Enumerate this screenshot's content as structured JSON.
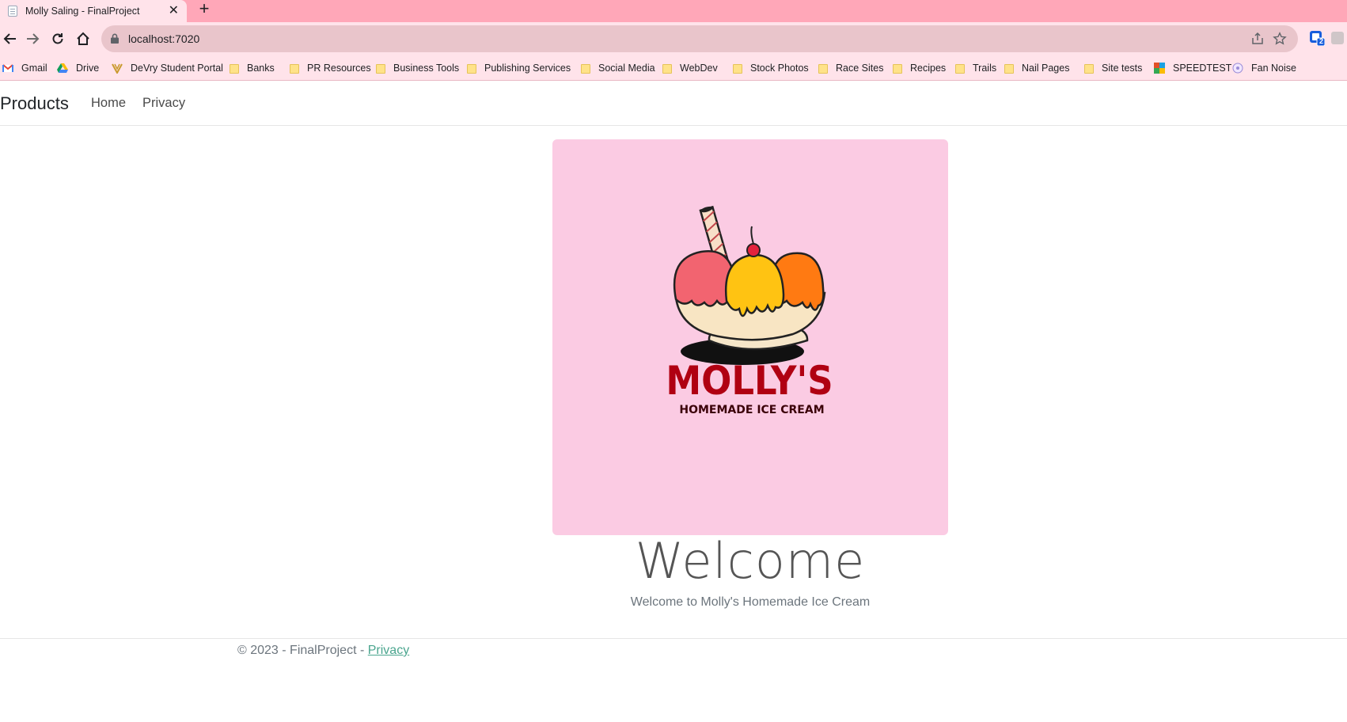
{
  "browser": {
    "tab_title": "Molly Saling - FinalProject",
    "url": "localhost:7020",
    "extension_badge": "2",
    "bookmarks": [
      {
        "label": "Gmail",
        "icon": "gmail-icon"
      },
      {
        "label": "Drive",
        "icon": "drive-icon"
      },
      {
        "label": "DeVry Student Portal",
        "icon": "devry-icon"
      },
      {
        "label": "Banks",
        "icon": "folder-icon"
      },
      {
        "label": "PR Resources",
        "icon": "folder-icon"
      },
      {
        "label": "Business Tools",
        "icon": "folder-icon"
      },
      {
        "label": "Publishing Services",
        "icon": "folder-icon"
      },
      {
        "label": "Social Media",
        "icon": "folder-icon"
      },
      {
        "label": "WebDev",
        "icon": "folder-icon"
      },
      {
        "label": "Stock Photos",
        "icon": "folder-icon"
      },
      {
        "label": "Race Sites",
        "icon": "folder-icon"
      },
      {
        "label": "Recipes",
        "icon": "folder-icon"
      },
      {
        "label": "Trails",
        "icon": "folder-icon"
      },
      {
        "label": "Nail Pages",
        "icon": "folder-icon"
      },
      {
        "label": "Site tests",
        "icon": "folder-icon"
      },
      {
        "label": "SPEEDTEST",
        "icon": "speedtest-icon"
      },
      {
        "label": "Fan Noise",
        "icon": "fan-noise-icon"
      }
    ]
  },
  "site": {
    "brand": "Products",
    "nav": [
      "Home",
      "Privacy"
    ],
    "logo": {
      "title": "MOLLY'S",
      "subtitle": "HOMEMADE ICE CREAM"
    },
    "welcome_title": "Welcome",
    "welcome_subtitle": "Welcome to Molly's Homemade Ice Cream",
    "footer_text": "© 2023 - FinalProject - ",
    "footer_link": "Privacy"
  },
  "colors": {
    "tab_strip": "#ffa7b8",
    "toolbar": "#ffe3ea",
    "hero_bg": "#fbcbe3",
    "logo_red": "#b00012"
  }
}
